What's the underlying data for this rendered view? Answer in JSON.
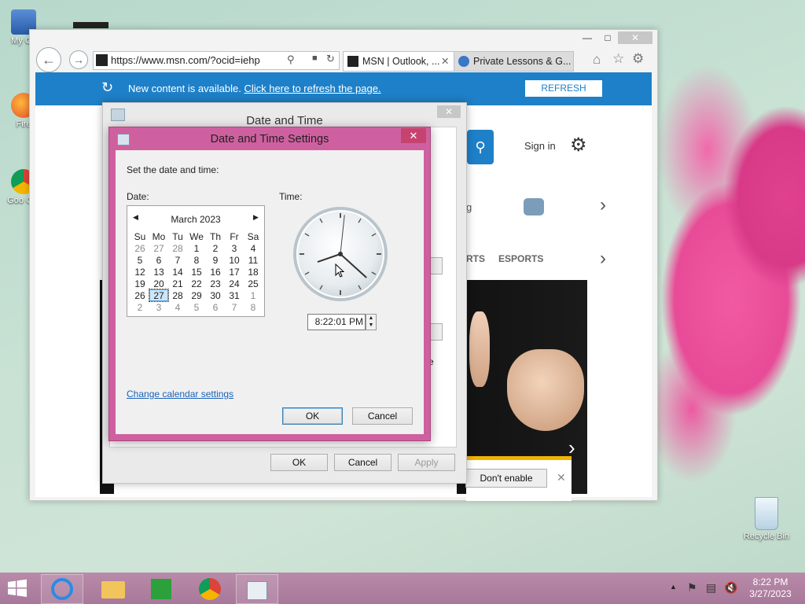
{
  "desktop": {
    "icons": [
      {
        "label": "My Co"
      },
      {
        "label": "Fire"
      },
      {
        "label": "Goo Chr"
      },
      {
        "label": "Recycle Bin"
      }
    ]
  },
  "browser": {
    "address": "https://www.msn.com/?ocid=iehp",
    "tabs": [
      {
        "label": "MSN | Outlook, ..."
      },
      {
        "label": "Private Lessons & G..."
      }
    ],
    "infobar": {
      "message": "New content is available.",
      "link": "Click here to refresh the page.",
      "button": "REFRESH"
    },
    "page": {
      "sign_in": "Sign in",
      "nav_partial": "RTS",
      "nav_esports": "ESPORTS",
      "letter_g": "g",
      "letter_e": "e",
      "notification_button": "Don't enable"
    }
  },
  "date_time_dialog": {
    "title": "Date and Time",
    "ok": "OK",
    "cancel": "Cancel",
    "apply": "Apply"
  },
  "settings_dialog": {
    "title": "Date and Time Settings",
    "instruction": "Set the date and time:",
    "date_label": "Date:",
    "time_label": "Time:",
    "month": "March 2023",
    "weekdays": [
      "Su",
      "Mo",
      "Tu",
      "We",
      "Th",
      "Fr",
      "Sa"
    ],
    "weeks": [
      [
        "26",
        "27",
        "28",
        "1",
        "2",
        "3",
        "4"
      ],
      [
        "5",
        "6",
        "7",
        "8",
        "9",
        "10",
        "11"
      ],
      [
        "12",
        "13",
        "14",
        "15",
        "16",
        "17",
        "18"
      ],
      [
        "19",
        "20",
        "21",
        "22",
        "23",
        "24",
        "25"
      ],
      [
        "26",
        "27",
        "28",
        "29",
        "30",
        "31",
        "1"
      ],
      [
        "2",
        "3",
        "4",
        "5",
        "6",
        "7",
        "8"
      ]
    ],
    "selected_day": "27",
    "time_value": "8:22:01 PM",
    "clock": {
      "hour": 8,
      "minute": 22,
      "second": 1
    },
    "change_calendar_link": "Change calendar settings",
    "ok": "OK",
    "cancel": "Cancel"
  },
  "taskbar": {
    "time": "8:22 PM",
    "date": "3/27/2023"
  }
}
